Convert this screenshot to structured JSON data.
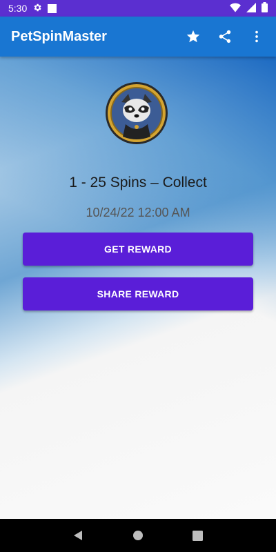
{
  "status_bar": {
    "time": "5:30",
    "icons": [
      "settings-icon",
      "notification-square-icon",
      "wifi-icon",
      "signal-icon",
      "battery-icon"
    ]
  },
  "app_bar": {
    "title": "PetSpinMaster",
    "actions": [
      "star-icon",
      "share-icon",
      "more-vert-icon"
    ]
  },
  "reward": {
    "title": "1 - 25 Spins – Collect",
    "date": "10/24/22 12:00 AM",
    "get_button": "GET REWARD",
    "share_button": "SHARE REWARD"
  },
  "nav_bar": {
    "items": [
      "back-icon",
      "home-icon",
      "recents-icon"
    ]
  },
  "colors": {
    "status_bar": "#5b2fd0",
    "app_bar": "#1976d2",
    "button": "#5a1ed8"
  }
}
